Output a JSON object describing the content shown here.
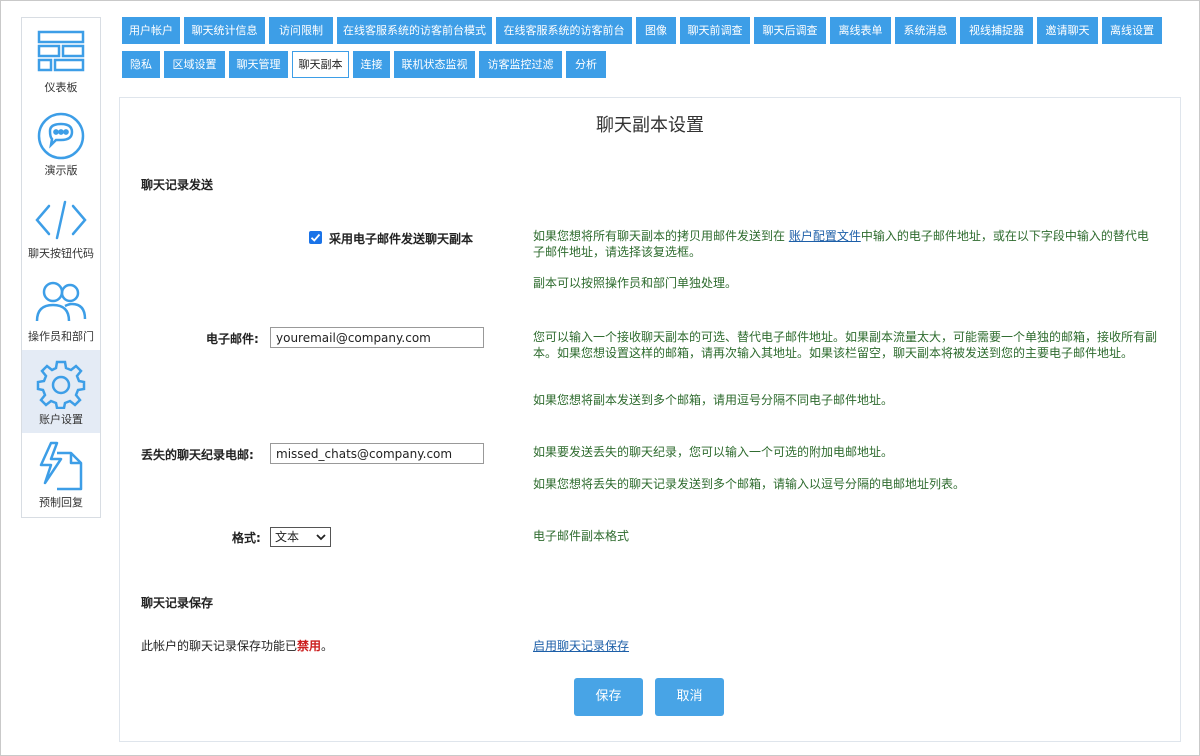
{
  "sidebar": {
    "items": [
      {
        "label": "仪表板",
        "icon": "dashboard-icon"
      },
      {
        "label": "演示版",
        "icon": "chat-bubble-icon"
      },
      {
        "label": "聊天按钮代码",
        "icon": "code-icon"
      },
      {
        "label": "操作员和部门",
        "icon": "users-icon"
      },
      {
        "label": "账户设置",
        "icon": "gear-icon"
      },
      {
        "label": "预制回复",
        "icon": "canned-reply-icon"
      }
    ]
  },
  "tabs": {
    "row1": [
      "用户帐户",
      "聊天统计信息",
      "访问限制",
      "在线客服系统的访客前台模式",
      "在线客服系统的访客前台",
      "图像",
      "聊天前调查",
      "聊天后调查",
      "离线表单",
      "系统消息",
      "视线捕捉器",
      "邀请聊天",
      "离线设置"
    ],
    "row2": [
      "隐私",
      "区域设置",
      "聊天管理",
      "聊天副本",
      "连接",
      "联机状态监视",
      "访客监控过滤",
      "分析"
    ],
    "active": "聊天副本"
  },
  "page": {
    "title": "聊天副本设置",
    "section_send": "聊天记录发送",
    "section_save": "聊天记录保存"
  },
  "form": {
    "checkbox_label": "采用电子邮件发送聊天副本",
    "checkbox_checked": true,
    "help_checkbox_pre": "如果您想将所有聊天副本的拷贝用邮件发送到在 ",
    "help_checkbox_link": "账户配置文件",
    "help_checkbox_post": "中输入的电子邮件地址，或在以下字段中输入的替代电子邮件地址，请选择该复选框。",
    "help_checkbox_2": "副本可以按照操作员和部门单独处理。",
    "email_label": "电子邮件:",
    "email_value": "youremail@company.com",
    "help_email_1": "您可以输入一个接收聊天副本的可选、替代电子邮件地址。如果副本流量太大，可能需要一个单独的邮箱，接收所有副本。如果您想设置这样的邮箱，请再次输入其地址。如果该栏留空，聊天副本将被发送到您的主要电子邮件地址。",
    "help_email_2": "如果您想将副本发送到多个邮箱，请用逗号分隔不同电子邮件地址。",
    "missed_label": "丢失的聊天纪录电邮:",
    "missed_value": "missed_chats@company.com",
    "help_missed_1": "如果要发送丢失的聊天纪录，您可以输入一个可选的附加电邮地址。",
    "help_missed_2": "如果您想将丢失的聊天记录发送到多个邮箱，请输入以逗号分隔的电邮地址列表。",
    "format_label": "格式:",
    "format_value": "文本",
    "help_format": "电子邮件副本格式",
    "save_status_pre": "此帐户的聊天记录保存功能已",
    "save_status_word": "禁用",
    "save_status_post": "。",
    "enable_link": "启用聊天记录保存",
    "save_button": "保存",
    "cancel_button": "取消"
  },
  "colors": {
    "tab_blue": "#3d9ee7",
    "help_green": "#2e6b2e",
    "disabled_red": "#cc1f1f",
    "link_blue": "#1d5fa8"
  }
}
